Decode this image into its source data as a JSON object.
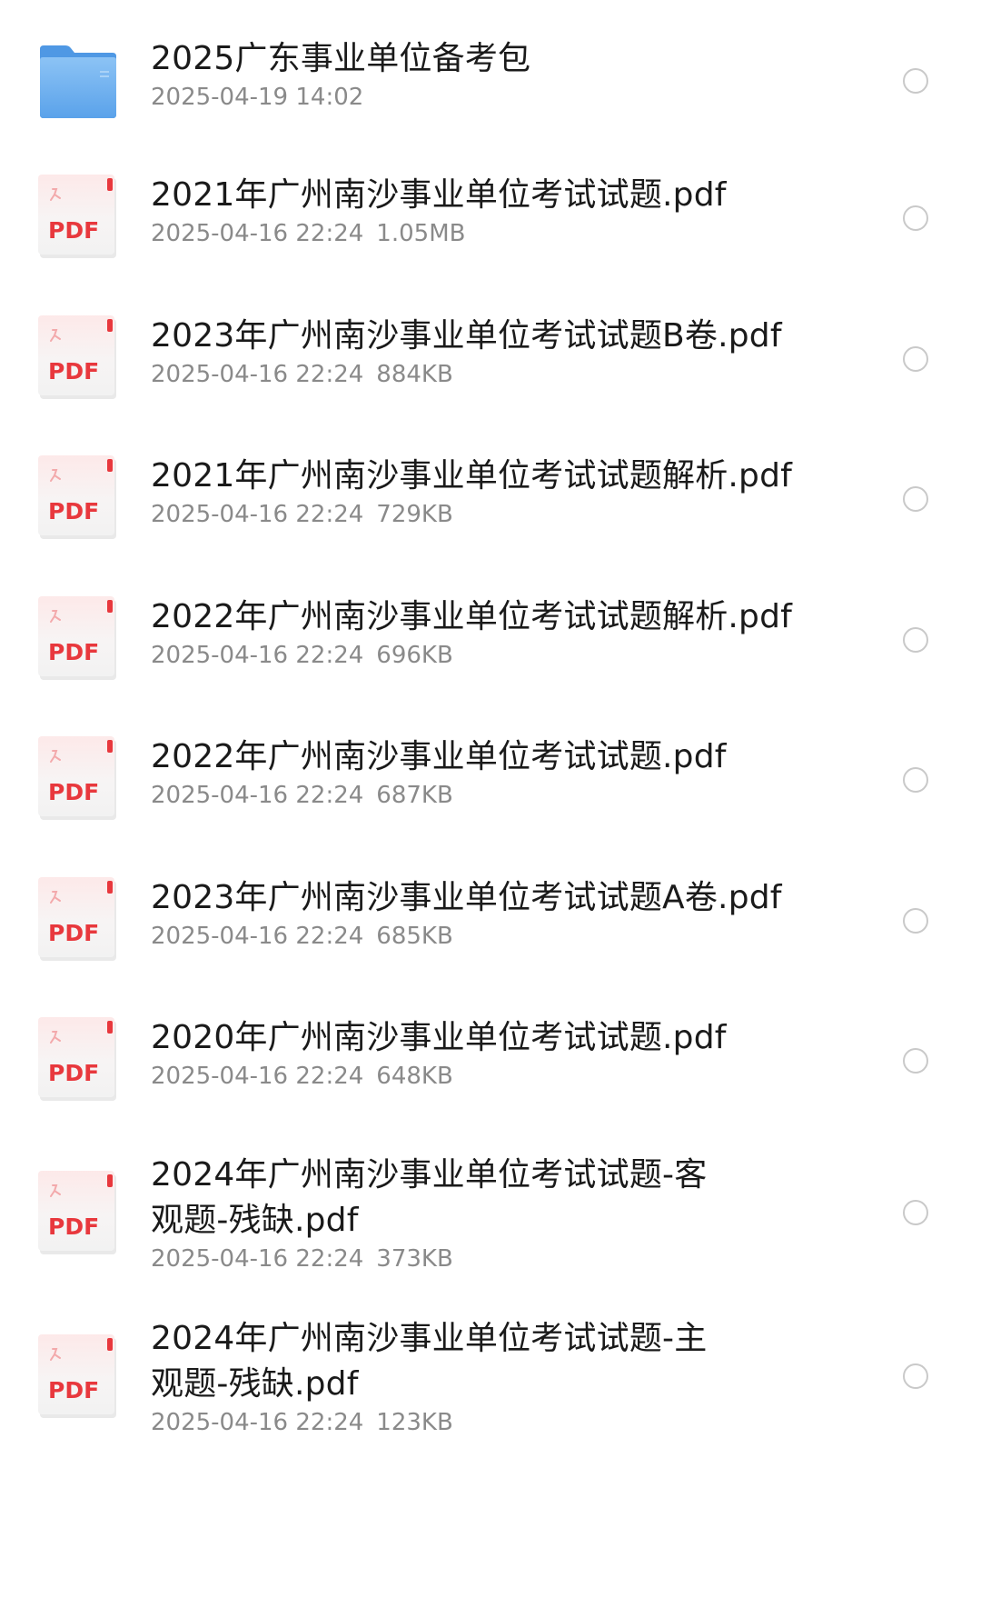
{
  "files": [
    {
      "icon": "folder-icon",
      "name": "2025广东事业单位备考包",
      "date": "2025-04-19 14:02",
      "size": ""
    },
    {
      "icon": "pdf-file-icon",
      "name": "2021年广州南沙事业单位考试试题.pdf",
      "date": "2025-04-16 22:24",
      "size": "1.05MB"
    },
    {
      "icon": "pdf-file-icon",
      "name": "2023年广州南沙事业单位考试试题B卷.pdf",
      "date": "2025-04-16 22:24",
      "size": "884KB"
    },
    {
      "icon": "pdf-file-icon",
      "name": "2021年广州南沙事业单位考试试题解析.pdf",
      "date": "2025-04-16 22:24",
      "size": "729KB"
    },
    {
      "icon": "pdf-file-icon",
      "name": "2022年广州南沙事业单位考试试题解析.pdf",
      "date": "2025-04-16 22:24",
      "size": "696KB"
    },
    {
      "icon": "pdf-file-icon",
      "name": "2022年广州南沙事业单位考试试题.pdf",
      "date": "2025-04-16 22:24",
      "size": "687KB"
    },
    {
      "icon": "pdf-file-icon",
      "name": "2023年广州南沙事业单位考试试题A卷.pdf",
      "date": "2025-04-16 22:24",
      "size": "685KB"
    },
    {
      "icon": "pdf-file-icon",
      "name": "2020年广州南沙事业单位考试试题.pdf",
      "date": "2025-04-16 22:24",
      "size": "648KB"
    },
    {
      "icon": "pdf-file-icon",
      "name": "2024年广州南沙事业单位考试试题-客观题-残缺.pdf",
      "date": "2025-04-16 22:24",
      "size": "373KB"
    },
    {
      "icon": "pdf-file-icon",
      "name": "2024年广州南沙事业单位考试试题-主观题-残缺.pdf",
      "date": "2025-04-16 22:24",
      "size": "123KB"
    }
  ],
  "pdf_icon_label": "PDF",
  "colors": {
    "folder": "#6aaef0",
    "pdf_red": "#e8383d",
    "title": "#1a1a1a",
    "meta": "#8a8a8a",
    "radio_border": "#c9c9c9"
  }
}
